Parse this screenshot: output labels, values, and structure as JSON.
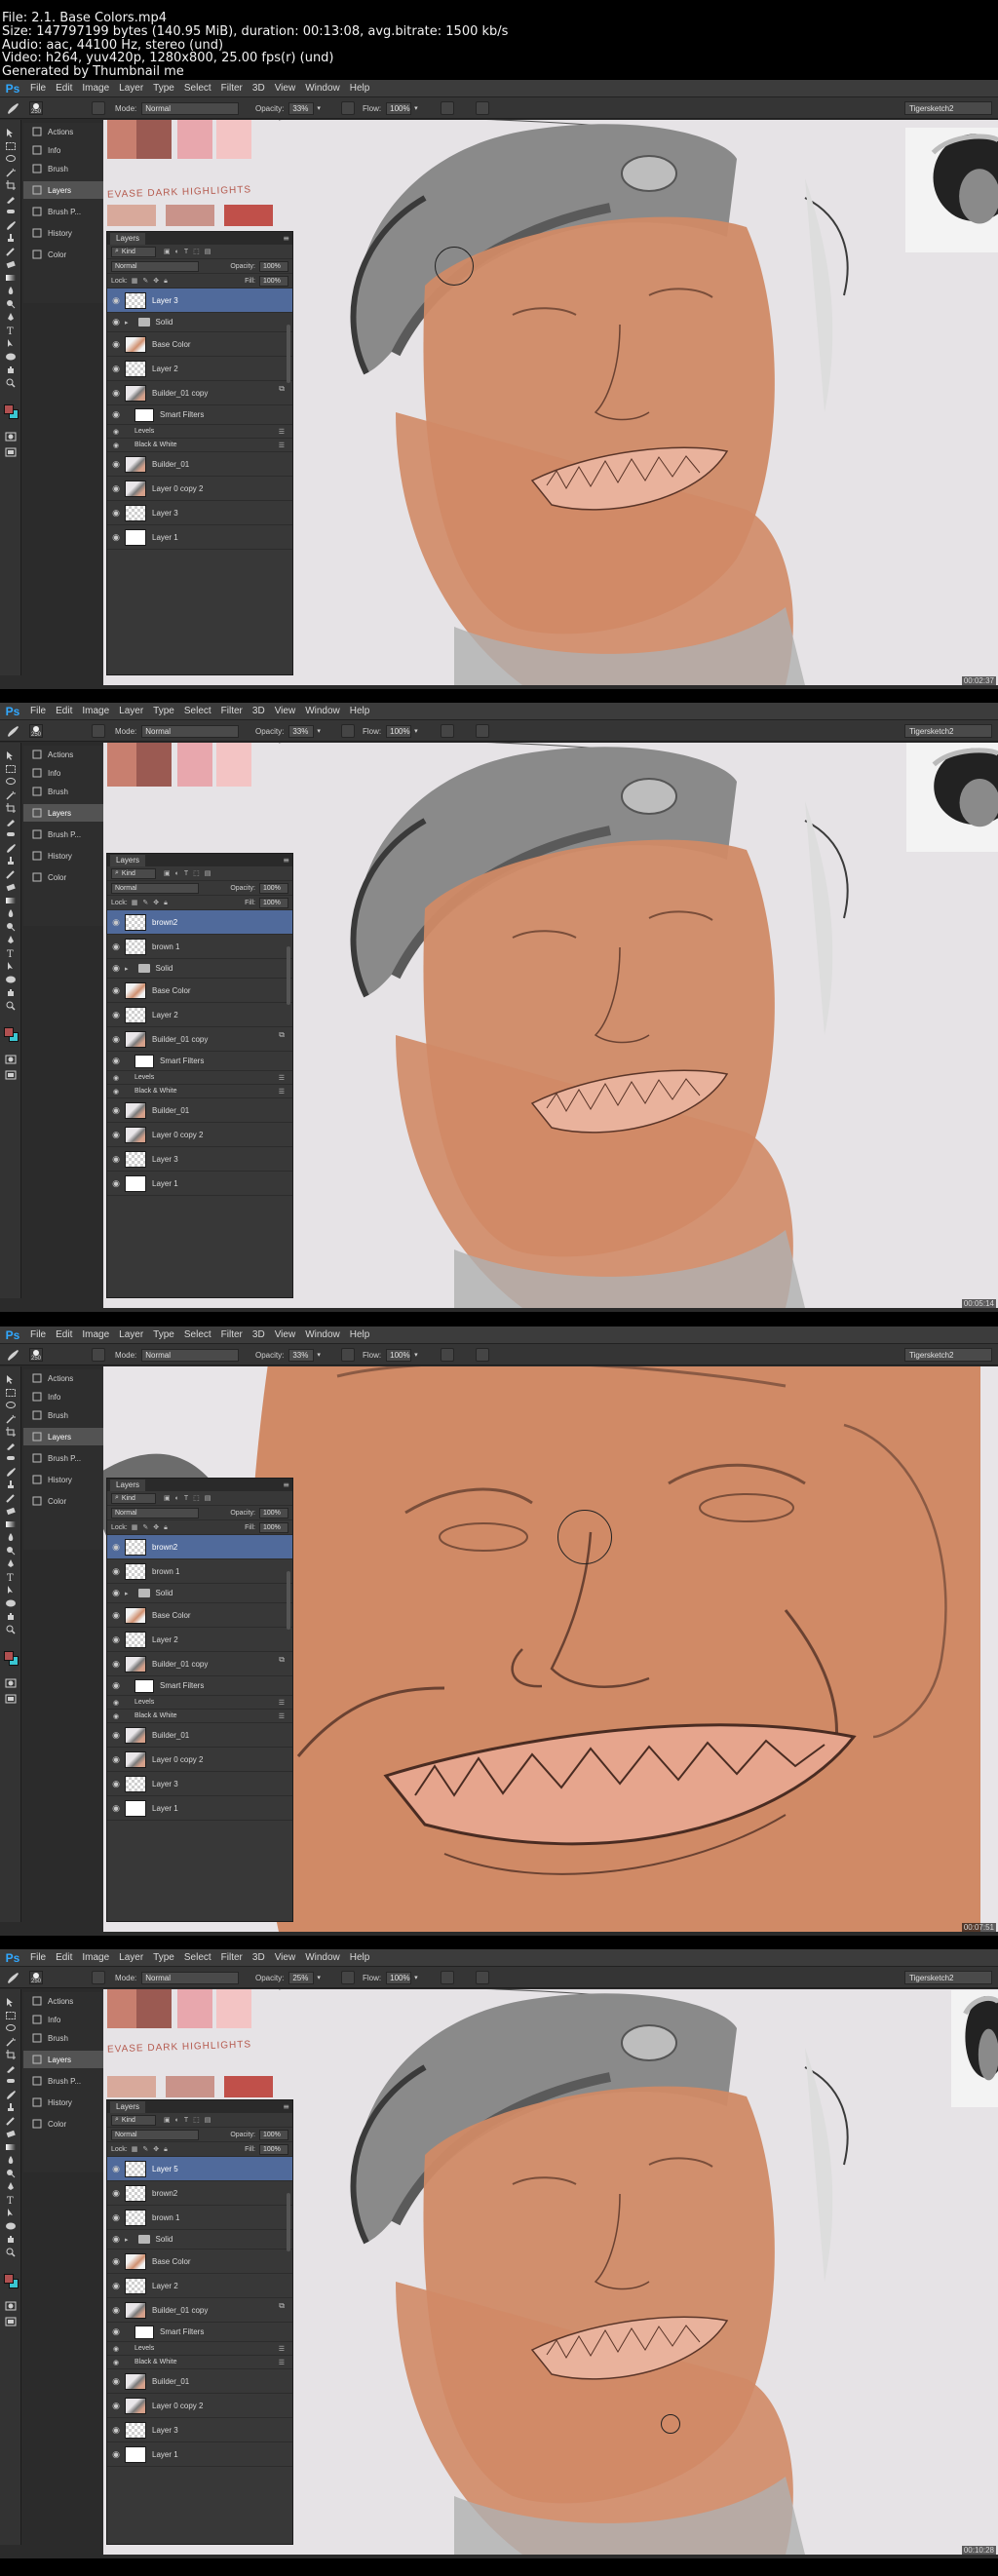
{
  "video_info": {
    "file": "File: 2.1. Base Colors.mp4",
    "size": "Size: 147797199 bytes (140.95 MiB), duration: 00:13:08, avg.bitrate: 1500 kb/s",
    "audio": "Audio: aac, 44100 Hz, stereo (und)",
    "video": "Video: h264, yuv420p, 1280x800, 25.00 fps(r) (und)",
    "generator": "Generated by Thumbnail me"
  },
  "app": {
    "logo": "Ps",
    "menus": [
      "File",
      "Edit",
      "Image",
      "Layer",
      "Type",
      "Select",
      "Filter",
      "3D",
      "View",
      "Window",
      "Help"
    ],
    "options": {
      "brush_size": "250",
      "mode_label": "Mode:",
      "mode_value": "Normal",
      "opacity_label": "Opacity:",
      "flow_label": "Flow:",
      "flow_value": "100%",
      "workspace": "Tigersketch2"
    },
    "dock": [
      "Actions",
      "Info",
      "Brush",
      "Layers",
      "Brush P...",
      "History",
      "Color"
    ],
    "layers_panel": {
      "tab": "Layers",
      "kind": "Kind",
      "blend": "Normal",
      "opacity_label": "Opacity:",
      "opacity_value": "100%",
      "lock_label": "Lock:",
      "fill_label": "Fill:",
      "fill_value": "100%"
    },
    "colors": {
      "ui_dark": "#2b2b2b",
      "panel": "#383838",
      "selected_layer": "#506a9b",
      "skin": "#d08a66",
      "canvas_bg": "#e6e3e6",
      "fg_swatch": "#b05050",
      "bg_swatch": "#3ac6d2",
      "ps_blue": "#31a8ff"
    },
    "icons": [
      "eye-icon",
      "folder-icon",
      "brush-icon",
      "link-icon",
      "fx-icon"
    ]
  },
  "swatches": {
    "note": "EVASE DARK HIGHLIGHTS"
  },
  "frames": [
    {
      "opacity": "33%",
      "timestamp": "00:02:37",
      "layers": [
        {
          "name": "Layer 3",
          "kind": "empty",
          "selected": true
        },
        {
          "name": "Solid",
          "kind": "folder"
        },
        {
          "name": "Base Color",
          "kind": "skin"
        },
        {
          "name": "Layer 2",
          "kind": "empty"
        },
        {
          "name": "Builder_01 copy",
          "kind": "art"
        },
        {
          "name": "Smart Filters",
          "kind": "smart"
        },
        {
          "name": "Levels",
          "kind": "filter"
        },
        {
          "name": "Black & White",
          "kind": "filter"
        },
        {
          "name": "Builder_01",
          "kind": "art"
        },
        {
          "name": "Layer 0 copy 2",
          "kind": "art"
        },
        {
          "name": "Layer 3",
          "kind": "empty"
        },
        {
          "name": "Layer 1",
          "kind": "white"
        }
      ]
    },
    {
      "opacity": "33%",
      "timestamp": "00:05:14",
      "layers": [
        {
          "name": "brown2",
          "kind": "empty",
          "selected": true
        },
        {
          "name": "brown 1",
          "kind": "empty"
        },
        {
          "name": "Solid",
          "kind": "folder"
        },
        {
          "name": "Base Color",
          "kind": "skin"
        },
        {
          "name": "Layer 2",
          "kind": "empty"
        },
        {
          "name": "Builder_01 copy",
          "kind": "art"
        },
        {
          "name": "Smart Filters",
          "kind": "smart"
        },
        {
          "name": "Levels",
          "kind": "filter"
        },
        {
          "name": "Black & White",
          "kind": "filter"
        },
        {
          "name": "Builder_01",
          "kind": "art"
        },
        {
          "name": "Layer 0 copy 2",
          "kind": "art"
        },
        {
          "name": "Layer 3",
          "kind": "empty"
        },
        {
          "name": "Layer 1",
          "kind": "white"
        }
      ]
    },
    {
      "opacity": "33%",
      "timestamp": "00:07:51",
      "layers": [
        {
          "name": "brown2",
          "kind": "empty",
          "selected": true
        },
        {
          "name": "brown 1",
          "kind": "empty"
        },
        {
          "name": "Solid",
          "kind": "folder"
        },
        {
          "name": "Base Color",
          "kind": "skin"
        },
        {
          "name": "Layer 2",
          "kind": "empty"
        },
        {
          "name": "Builder_01 copy",
          "kind": "art"
        },
        {
          "name": "Smart Filters",
          "kind": "smart"
        },
        {
          "name": "Levels",
          "kind": "filter"
        },
        {
          "name": "Black & White",
          "kind": "filter"
        },
        {
          "name": "Builder_01",
          "kind": "art"
        },
        {
          "name": "Layer 0 copy 2",
          "kind": "art"
        },
        {
          "name": "Layer 3",
          "kind": "empty"
        },
        {
          "name": "Layer 1",
          "kind": "white"
        }
      ]
    },
    {
      "opacity": "25%",
      "timestamp": "00:10:28",
      "layers": [
        {
          "name": "Layer 5",
          "kind": "empty",
          "selected": true
        },
        {
          "name": "brown2",
          "kind": "empty"
        },
        {
          "name": "brown 1",
          "kind": "empty"
        },
        {
          "name": "Solid",
          "kind": "folder"
        },
        {
          "name": "Base Color",
          "kind": "skin"
        },
        {
          "name": "Layer 2",
          "kind": "empty"
        },
        {
          "name": "Builder_01 copy",
          "kind": "art"
        },
        {
          "name": "Smart Filters",
          "kind": "smart"
        },
        {
          "name": "Levels",
          "kind": "filter"
        },
        {
          "name": "Black & White",
          "kind": "filter"
        },
        {
          "name": "Builder_01",
          "kind": "art"
        },
        {
          "name": "Layer 0 copy 2",
          "kind": "art"
        },
        {
          "name": "Layer 3",
          "kind": "empty"
        },
        {
          "name": "Layer 1",
          "kind": "white"
        }
      ]
    }
  ]
}
